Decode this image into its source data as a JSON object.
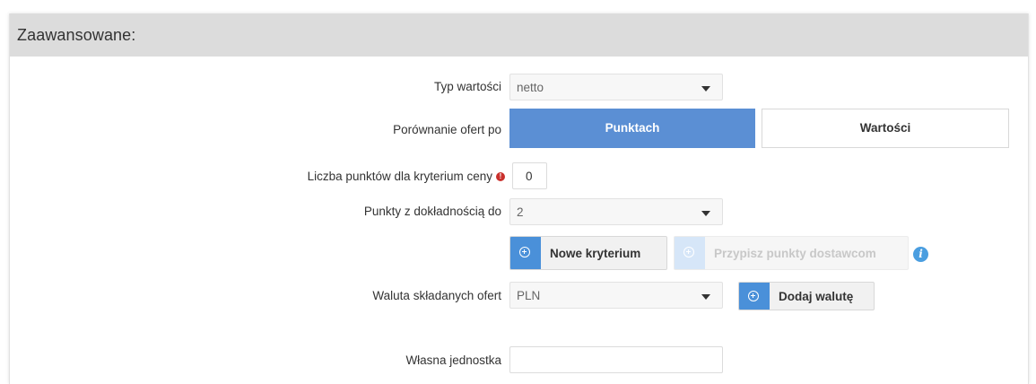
{
  "panel": {
    "title": "Zaawansowane:"
  },
  "value_type": {
    "label": "Typ wartości",
    "selected": "netto"
  },
  "comparison": {
    "label": "Porównanie ofert po",
    "options": [
      "Punktach",
      "Wartości"
    ],
    "active": "Punktach"
  },
  "price_points": {
    "label": "Liczba punktów dla kryterium ceny",
    "value": "0"
  },
  "precision": {
    "label": "Punkty z dokładnością do",
    "selected": "2"
  },
  "criteria_buttons": {
    "new_criterion": "Nowe kryterium",
    "assign_points": "Przypisz punkty dostawcom"
  },
  "currency": {
    "label": "Waluta składanych ofert",
    "selected": "PLN",
    "add_button": "Dodaj walutę"
  },
  "custom_unit": {
    "label": "Własna jednostka",
    "value": ""
  },
  "colors": {
    "accent": "#5b8fd4",
    "icon_blue": "#4a90d9",
    "header_bg": "#dcdcdc",
    "warning": "#c9302c"
  },
  "icons": [
    "plus-circle-icon",
    "info-icon",
    "warning-icon",
    "chevron-down-icon"
  ]
}
